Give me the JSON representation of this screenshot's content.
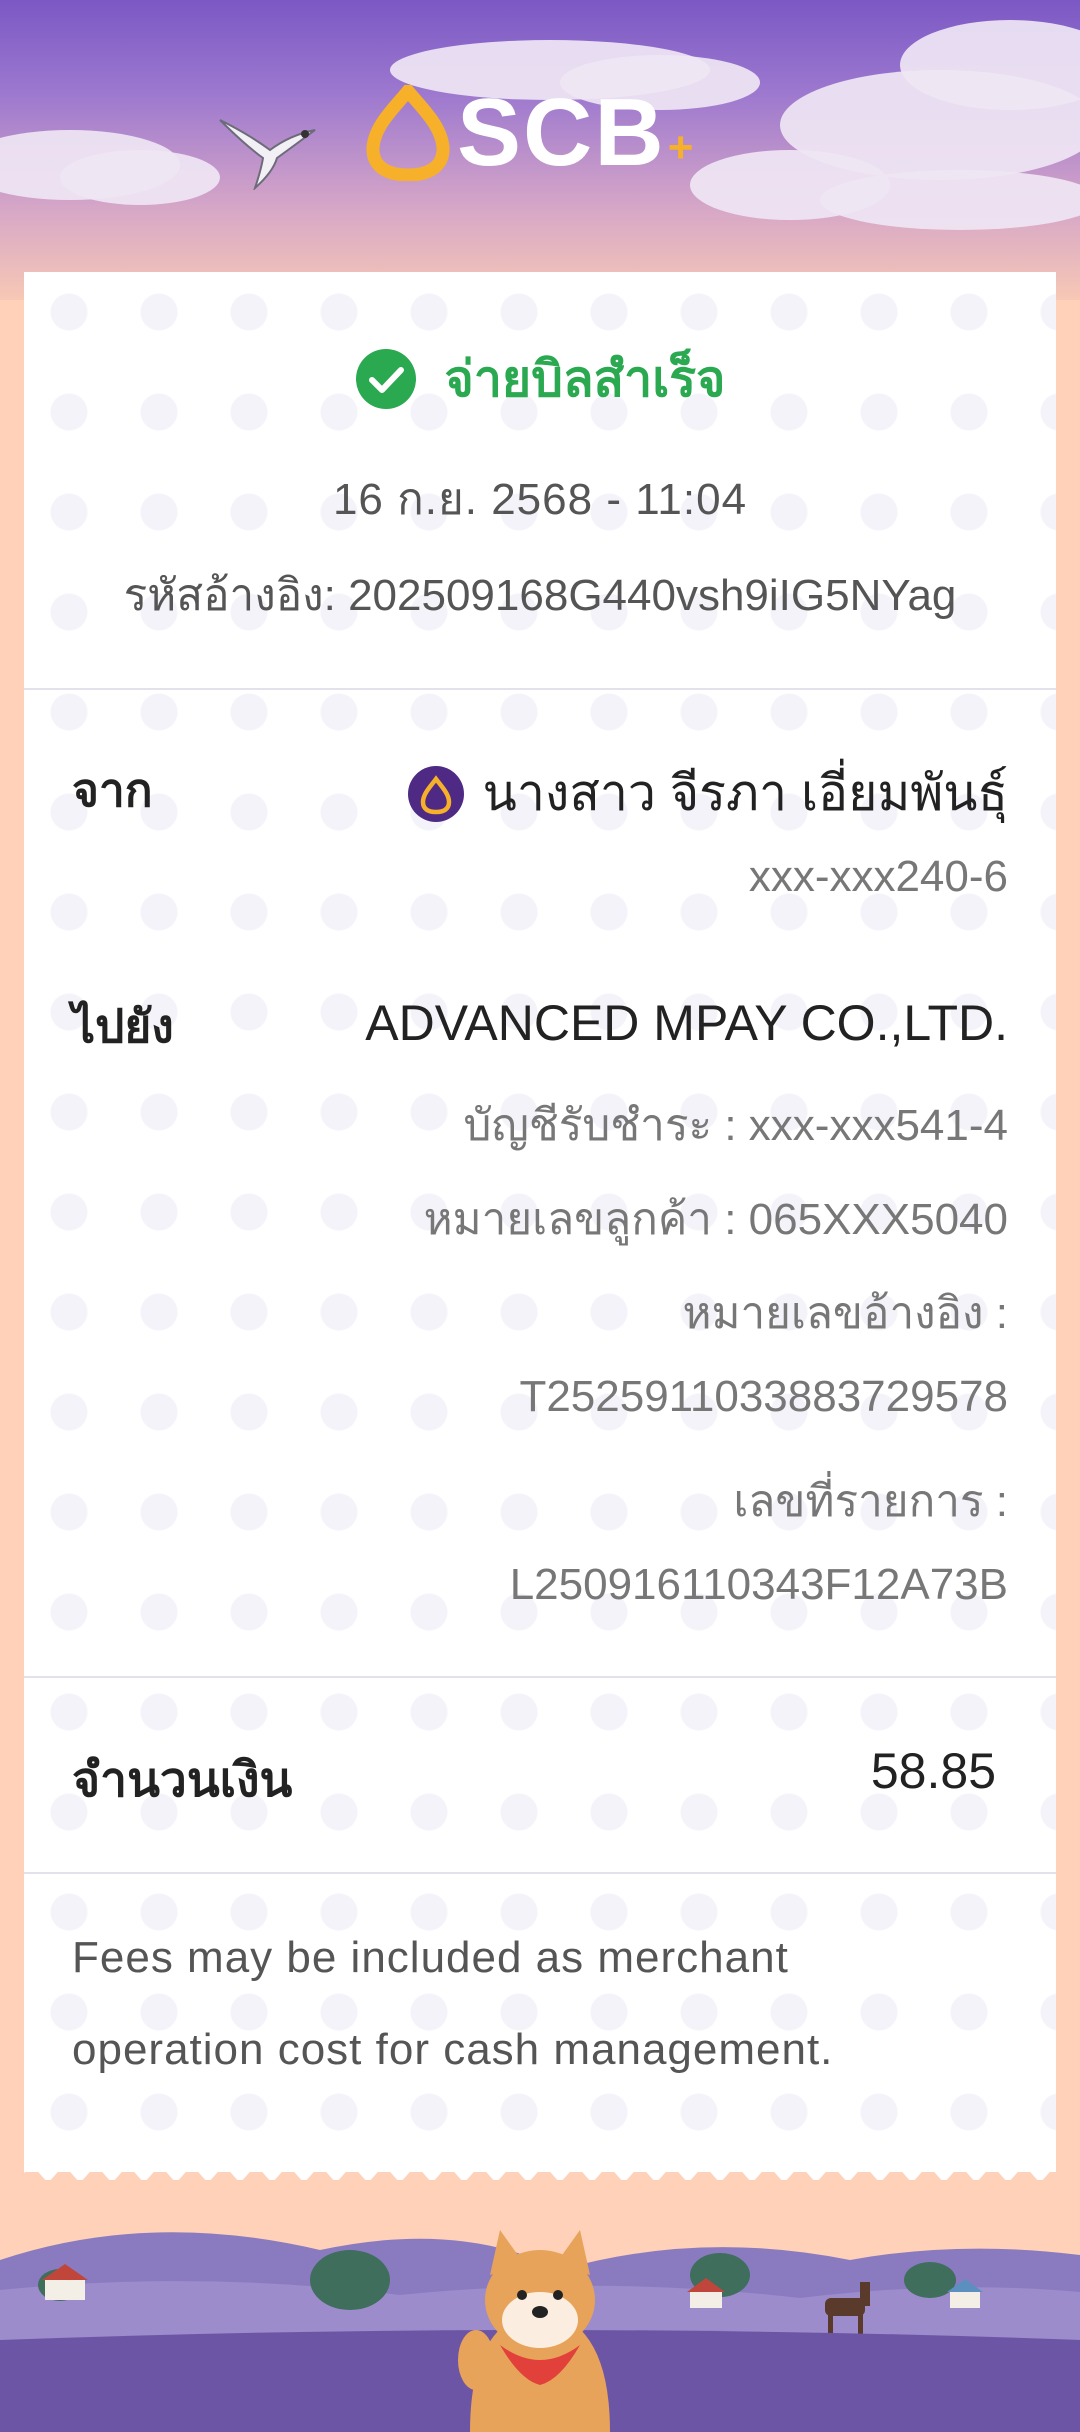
{
  "brand": {
    "name": "SCB",
    "plus": "+"
  },
  "receipt": {
    "status": "จ่ายบิลสำเร็จ",
    "datetime": "16 ก.ย. 2568 - 11:04",
    "reference": "รหัสอ้างอิง: 202509168G440vsh9iIG5NYag"
  },
  "from": {
    "label": "จาก",
    "name": "นางสาว จีรภา เอี่ยมพันธุ์",
    "account": "xxx-xxx240-6"
  },
  "to": {
    "label": "ไปยัง",
    "name": "ADVANCED MPAY CO.,LTD.",
    "biller_account": "บัญชีรับชำระ : xxx-xxx541-4",
    "customer_no": "หมายเลขลูกค้า : 065XXX5040",
    "ref_label": "หมายเลขอ้างอิง :",
    "ref_value": "T2525911033883729578",
    "txn_label": "เลขที่รายการ :",
    "txn_value": "L250916110343F12A73B"
  },
  "amount": {
    "label": "จำนวนเงิน",
    "value": "58.85"
  },
  "note": "Fees may be included as merchant operation cost for cash management.",
  "colors": {
    "success": "#2aa951",
    "scb_purple": "#4e2a84",
    "scb_gold": "#f6b02a"
  },
  "icons": [
    "check-circle-icon",
    "scb-logo-icon",
    "bird-icon",
    "scb-account-avatar-icon"
  ]
}
